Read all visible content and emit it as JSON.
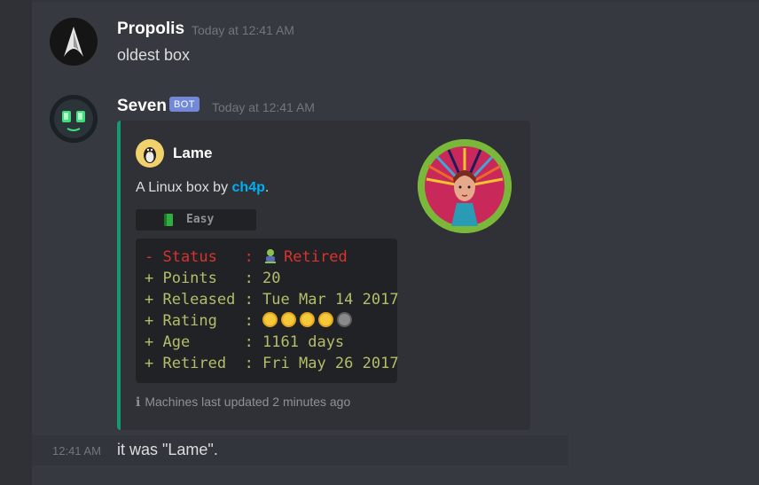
{
  "messages": [
    {
      "author": "Propolis",
      "timestamp": "Today at 12:41 AM",
      "text": "oldest box"
    },
    {
      "author": "Seven",
      "bot_tag": "BOT",
      "timestamp": "Today at 12:41 AM",
      "embed": {
        "color": "#169972",
        "author_name": "Lame",
        "description_prefix": "A Linux box by ",
        "description_link": "ch4p",
        "description_suffix": ".",
        "difficulty": "Easy",
        "stats": {
          "status_key": "- Status   : ",
          "status_value": "Retired",
          "lines": [
            "+ Points   : 20",
            "+ Released : Tue Mar 14 2017",
            "+ Rating   : ",
            "+ Age      : 1161 days",
            "+ Retired  : Fri May 26 2017"
          ],
          "rating_full": 4,
          "rating_max": 5
        },
        "footer": "Machines last updated 2 minutes ago",
        "footer_icon": "info-icon"
      }
    },
    {
      "timestamp": "12:41 AM",
      "text": "it was \"Lame\"."
    }
  ]
}
